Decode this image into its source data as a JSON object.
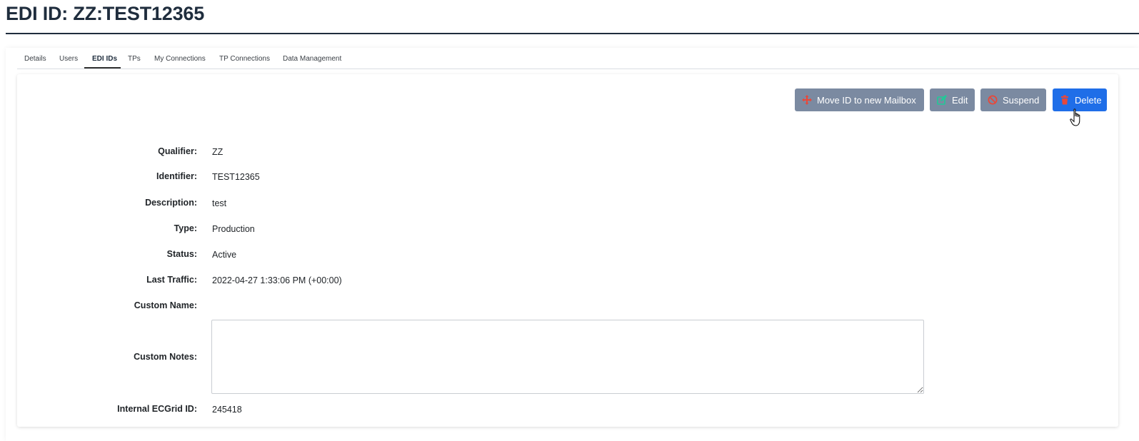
{
  "page": {
    "title": "EDI ID: ZZ:TEST12365"
  },
  "tabs": [
    {
      "label": "Details"
    },
    {
      "label": "Users"
    },
    {
      "label": "EDI IDs",
      "active": true
    },
    {
      "label": "TPs"
    },
    {
      "label": "My Connections"
    },
    {
      "label": "TP Connections"
    },
    {
      "label": "Data Management"
    }
  ],
  "actions": {
    "move": {
      "label": "Move ID to new Mailbox",
      "icon": "move-arrows-icon"
    },
    "edit": {
      "label": "Edit",
      "icon": "edit-pencil-icon"
    },
    "suspend": {
      "label": "Suspend",
      "icon": "ban-icon"
    },
    "delete": {
      "label": "Delete",
      "icon": "trash-icon"
    }
  },
  "fields": {
    "qualifier": {
      "label": "Qualifier:",
      "value": "ZZ"
    },
    "identifier": {
      "label": "Identifier:",
      "value": "TEST12365"
    },
    "description": {
      "label": "Description:",
      "value": "test"
    },
    "type": {
      "label": "Type:",
      "value": "Production"
    },
    "status": {
      "label": "Status:",
      "value": "Active"
    },
    "last_traffic": {
      "label": "Last Traffic:",
      "value": "2022-04-27 1:33:06 PM (+00:00)"
    },
    "custom_name": {
      "label": "Custom Name:",
      "value": ""
    },
    "custom_notes": {
      "label": "Custom Notes:",
      "value": ""
    },
    "internal_id": {
      "label": "Internal ECGrid ID:",
      "value": "245418"
    }
  },
  "colors": {
    "header_text": "#1f2d3d",
    "button_gray": "#7b8aa1",
    "button_primary": "#1f6ee8",
    "icon_move": "#e8483a",
    "icon_edit": "#20c997",
    "icon_suspend": "#e8483a",
    "icon_delete": "#e8483a"
  }
}
